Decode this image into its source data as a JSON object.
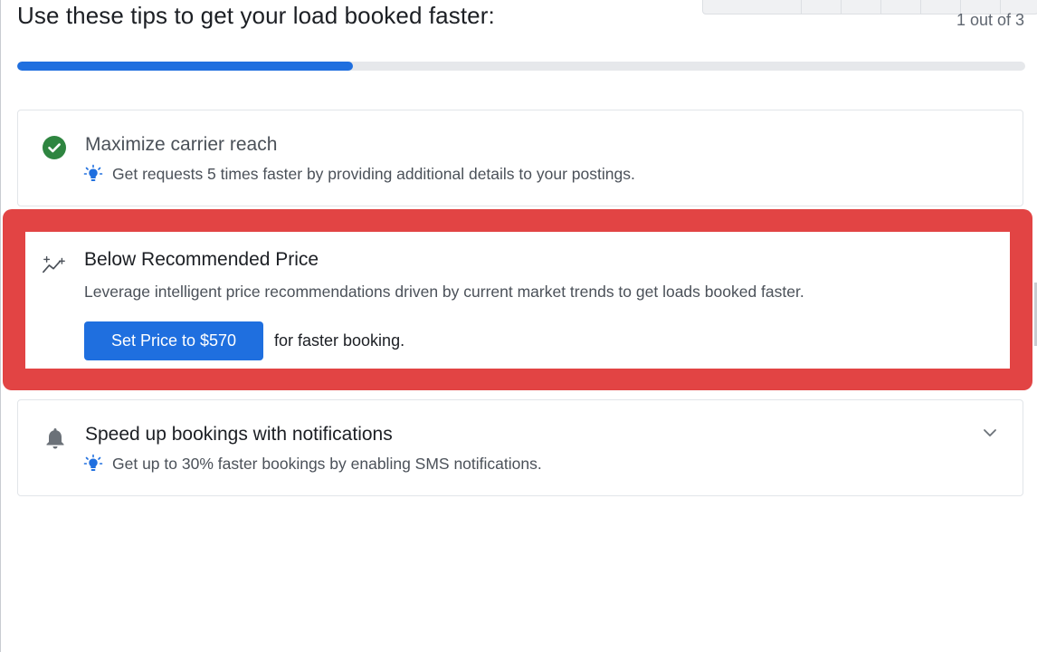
{
  "header": {
    "title": "Use these tips to get your load booked faster:",
    "progress_text": "1 out of 3",
    "progress_fraction": 0.333
  },
  "tips": {
    "carrier_reach": {
      "title": "Maximize carrier reach",
      "tip": "Get requests 5 times faster by providing additional details to your postings.",
      "status_icon": "check-circle-icon",
      "status_color": "#2e8540"
    },
    "recommended_price": {
      "title": "Below Recommended Price",
      "description": "Leverage intelligent price recommendations driven by current market trends to get loads booked faster.",
      "button_label": "Set Price to $570",
      "after_button_text": "for faster booking.",
      "icon": "trend-sparkle-icon",
      "highlight_color": "#e24444"
    },
    "notifications": {
      "title": "Speed up bookings with notifications",
      "tip": "Get up to 30% faster bookings by enabling SMS notifications.",
      "icon": "bell-icon",
      "expand_icon": "chevron-down-icon"
    }
  },
  "colors": {
    "accent": "#1f6fdf",
    "tip_bulb": "#1f6fdf",
    "track": "#e6e8eb"
  }
}
